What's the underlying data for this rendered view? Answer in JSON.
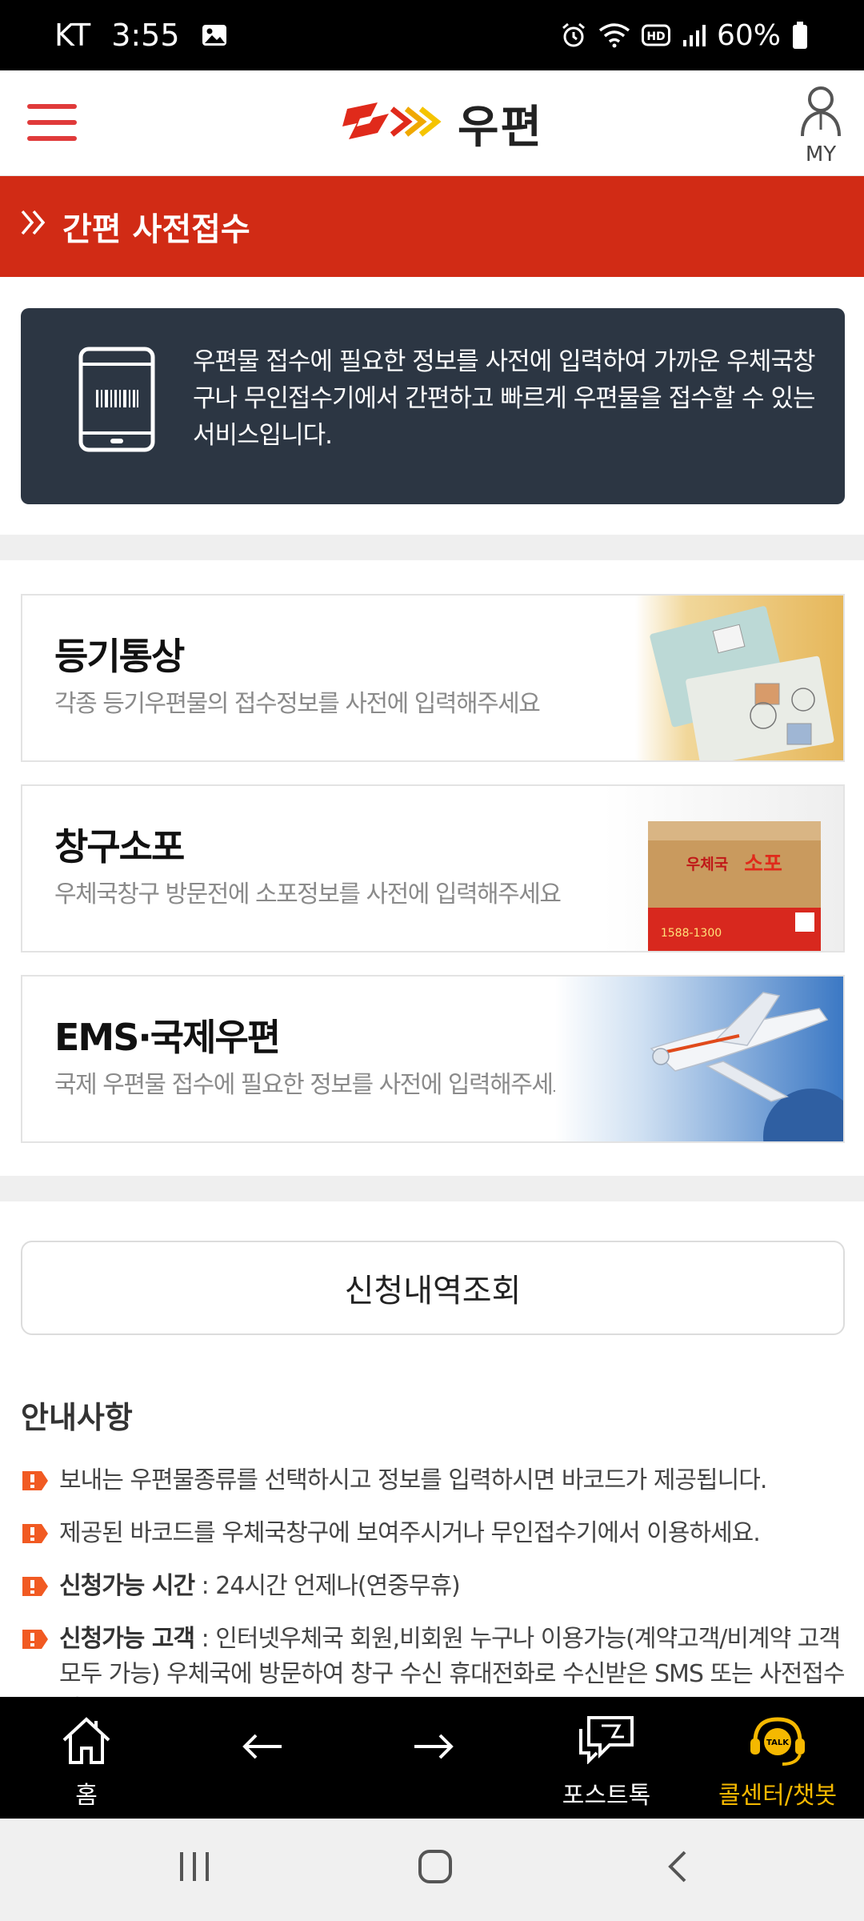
{
  "status_bar": {
    "carrier": "KT",
    "time": "3:55",
    "battery": "60%",
    "icons": [
      "gallery-icon",
      "alarm-icon",
      "wifi-icon",
      "hd-icon",
      "signal-icon",
      "battery-icon"
    ]
  },
  "header": {
    "logo_text": "우편",
    "my_label": "MY",
    "menu_icon": "hamburger-icon"
  },
  "page_title": {
    "chevron": "»",
    "text": "간편 사전접수"
  },
  "intro": {
    "text": "우편물 접수에 필요한 정보를 사전에 입력하여 가까운 우체국창구나 무인접수기에서 간편하고 빠르게 우편물을 접수할 수 있는 서비스입니다."
  },
  "services": [
    {
      "title": "등기통상",
      "description": "각종 등기우편물의 접수정보를 사전에 입력해주세요"
    },
    {
      "title": "창구소포",
      "description": "우체국창구 방문전에 소포정보를 사전에 입력해주세요"
    },
    {
      "title": "EMS·국제우편",
      "description": "국제 우편물 접수에 필요한 정보를 사전에 입력해주세요"
    }
  ],
  "box_art": {
    "brand": "우체국 소포",
    "phone": "1588-1300"
  },
  "history_button": "신청내역조회",
  "notice": {
    "title": "안내사항",
    "items": [
      {
        "bold": "",
        "text": "보내는 우편물종류를 선택하시고 정보를 입력하시면 바코드가 제공됩니다."
      },
      {
        "bold": "",
        "text": "제공된 바코드를 우체국창구에 보여주시거나 무인접수기에서 이용하세요."
      },
      {
        "bold": "신청가능 시간",
        "text": " : 24시간 언제나(연중무휴)"
      },
      {
        "bold": "신청가능 고객",
        "text": " : 인터넷우체국 회원,비회원 누구나 이용가능(계약고객/비계약 고객 모두 가능) 우체국에 방문하여 창구 수신 휴대전화로 수신받은 SMS 또는 사전접수번호"
      }
    ]
  },
  "app_nav": {
    "home": "홈",
    "back": "",
    "forward": "",
    "posttalk": "포스트톡",
    "callcenter": "콜센터/챗봇",
    "callcenter_color": "#f5b800",
    "talk_badge": "TALK"
  },
  "colors": {
    "brand_red": "#d12b15",
    "info_bg": "#2c3643",
    "accent_yellow": "#f5b800"
  }
}
